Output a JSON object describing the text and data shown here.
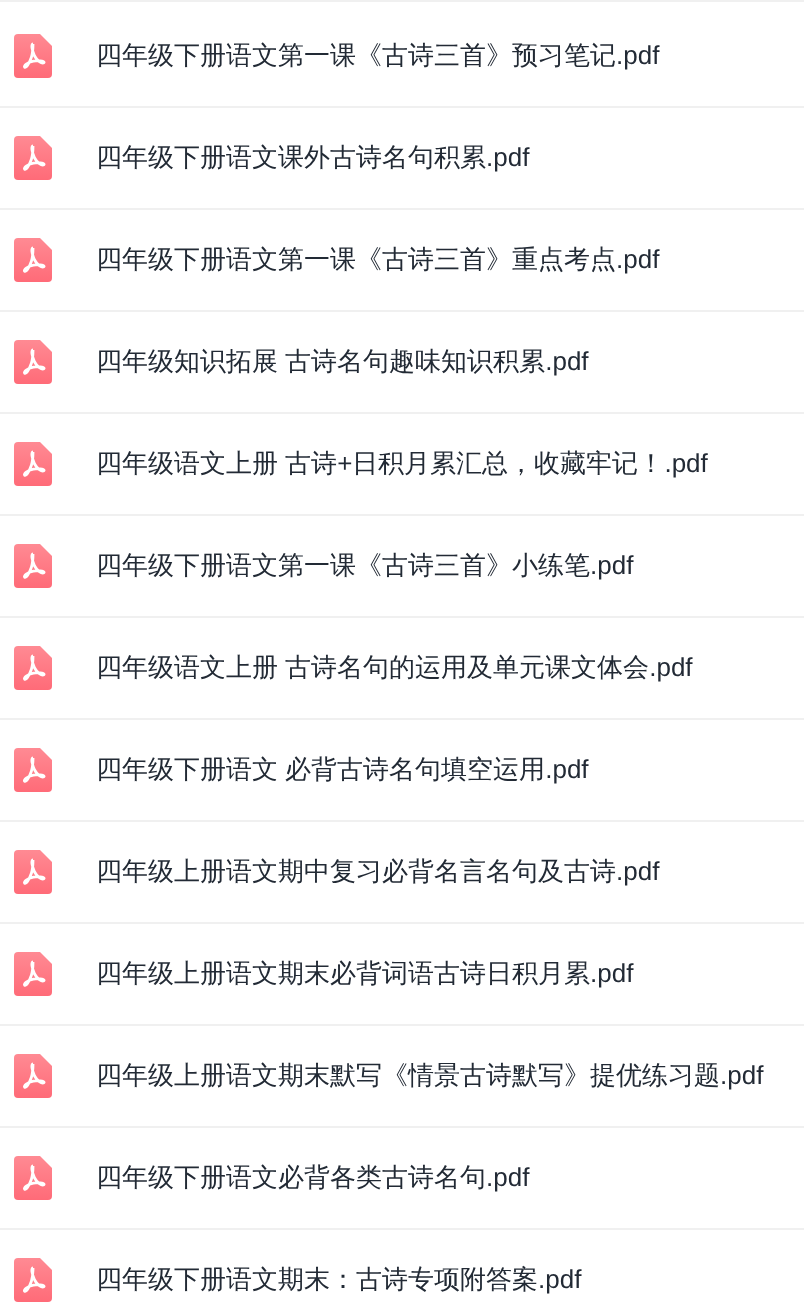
{
  "files": [
    {
      "name": "四年级下册语文第一课《古诗三首》预习笔记.pdf"
    },
    {
      "name": "四年级下册语文课外古诗名句积累.pdf"
    },
    {
      "name": "四年级下册语文第一课《古诗三首》重点考点.pdf"
    },
    {
      "name": "四年级知识拓展 古诗名句趣味知识积累.pdf"
    },
    {
      "name": "四年级语文上册 古诗+日积月累汇总，收藏牢记！.pdf"
    },
    {
      "name": "四年级下册语文第一课《古诗三首》小练笔.pdf"
    },
    {
      "name": "四年级语文上册 古诗名句的运用及单元课文体会.pdf"
    },
    {
      "name": "四年级下册语文 必背古诗名句填空运用.pdf"
    },
    {
      "name": "四年级上册语文期中复习必背名言名句及古诗.pdf"
    },
    {
      "name": "四年级上册语文期末必背词语古诗日积月累.pdf"
    },
    {
      "name": "四年级上册语文期末默写《情景古诗默写》提优练习题.pdf"
    },
    {
      "name": "四年级下册语文必背各类古诗名句.pdf"
    },
    {
      "name": "四年级下册语文期末：古诗专项附答案.pdf"
    }
  ]
}
